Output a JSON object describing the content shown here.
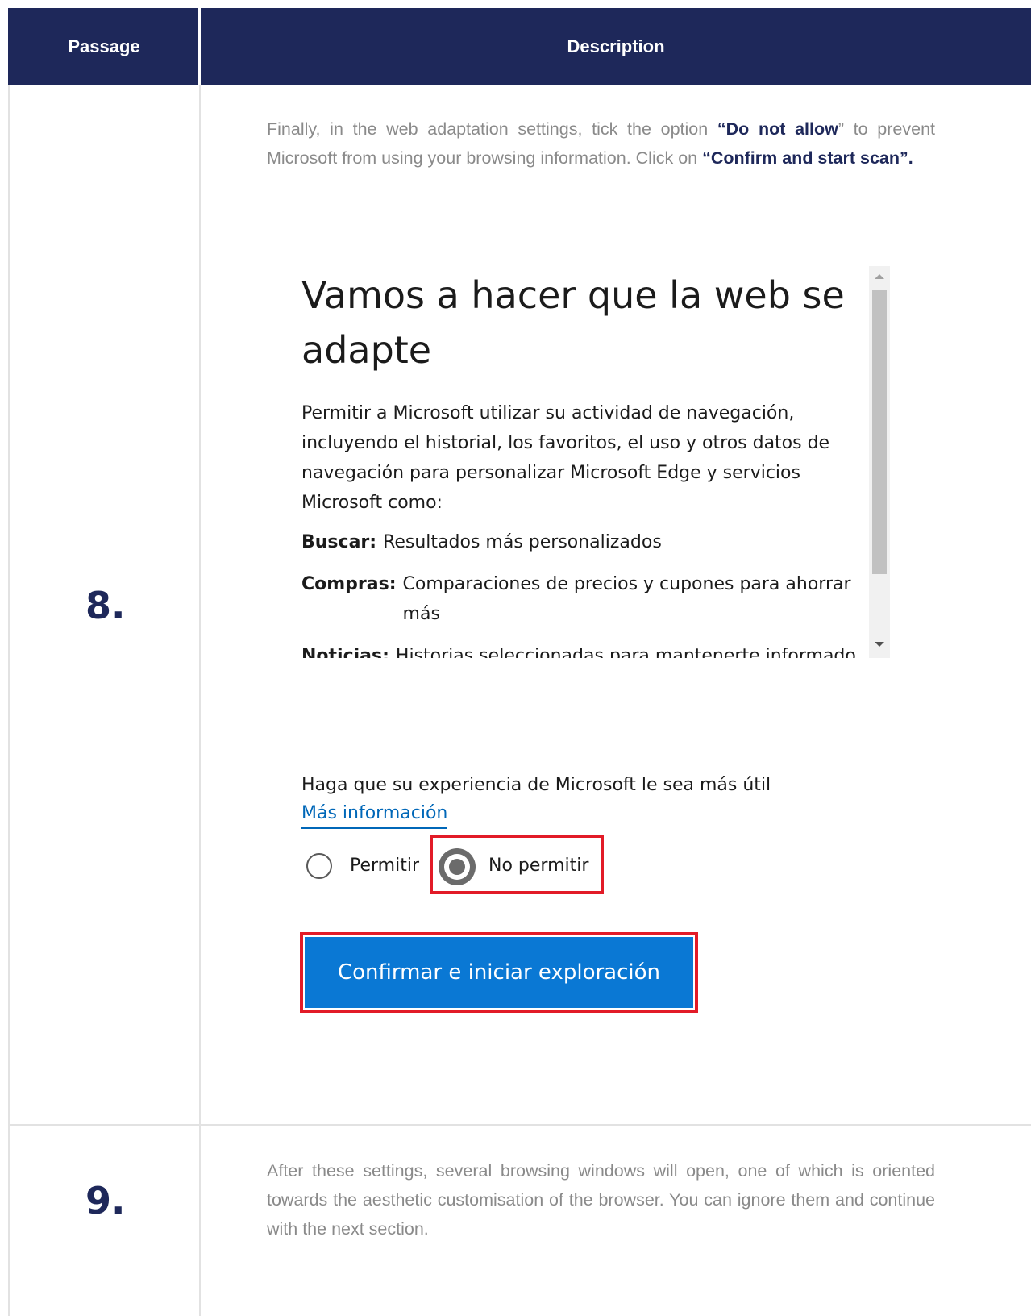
{
  "header": {
    "passage_label": "Passage",
    "description_label": "Description"
  },
  "rows": [
    {
      "number": "8.",
      "text_parts": [
        "Finally, in the web adaptation settings, tick the option ",
        "“Do not allow",
        "” to prevent Microsoft from using your browsing information. Click on ",
        "“Confirm and start scan”."
      ],
      "screenshot": {
        "title": "Vamos a hacer que la web se adapte",
        "paragraph": "Permitir a Microsoft utilizar su actividad de navegación, incluyendo el historial, los favoritos, el uso y otros datos de navegación para personalizar Microsoft Edge y servicios Microsoft como:",
        "items": [
          {
            "key": "Buscar:",
            "value": "Resultados más personalizados"
          },
          {
            "key": "Compras:",
            "value": "Comparaciones de precios y cupones para ahorrar más"
          },
          {
            "key": "Noticias:",
            "value": "Historias seleccionadas para mantenerte informado"
          }
        ],
        "help_text": "Haga que su experiencia de Microsoft le sea más útil",
        "link": "Más información",
        "radio_allow": "Permitir",
        "radio_deny": "No permitir",
        "selected_option": "No permitir",
        "button": "Confirmar e iniciar exploración",
        "highlight_color": "#e21b27",
        "button_color": "#0a78d4"
      }
    },
    {
      "number": "9.",
      "text": "After these settings, several browsing windows will open, one of which is oriented towards the aesthetic customisation of the browser. You can ignore them and continue with the next section."
    }
  ],
  "colors": {
    "header_bg": "#1e285a",
    "accent": "#1e285a",
    "body_text": "#8a8a8a"
  }
}
